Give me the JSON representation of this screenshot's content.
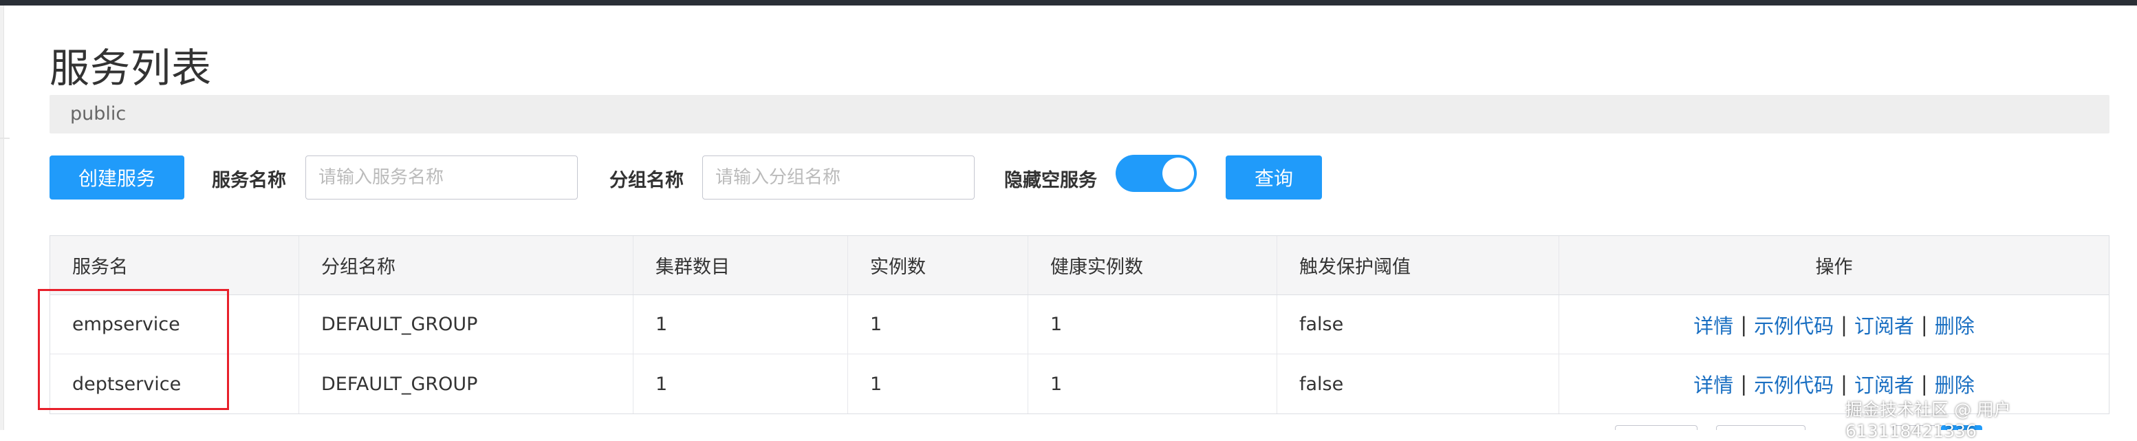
{
  "page": {
    "title": "服务列表",
    "namespace": "public"
  },
  "toolbar": {
    "create_label": "创建服务",
    "service_name_label": "服务名称",
    "service_name_placeholder": "请输入服务名称",
    "group_name_label": "分组名称",
    "group_name_placeholder": "请输入分组名称",
    "hide_empty_label": "隐藏空服务",
    "hide_empty_on": true,
    "query_label": "查询"
  },
  "table": {
    "columns": [
      "服务名",
      "分组名称",
      "集群数目",
      "实例数",
      "健康实例数",
      "触发保护阈值",
      "操作"
    ],
    "rows": [
      {
        "service": "empservice",
        "group": "DEFAULT_GROUP",
        "clusters": "1",
        "instances": "1",
        "healthy": "1",
        "protect": "false"
      },
      {
        "service": "deptservice",
        "group": "DEFAULT_GROUP",
        "clusters": "1",
        "instances": "1",
        "healthy": "1",
        "protect": "false"
      }
    ],
    "actions": {
      "detail": "详情",
      "sample_code": "示例代码",
      "subscribers": "订阅者",
      "delete": "删除",
      "separator": "|"
    }
  },
  "watermark": "掘金技术社区 @ 用户613118421336",
  "colors": {
    "primary": "#209bfa",
    "link": "#1a6fc2",
    "highlight": "#e8202b"
  }
}
